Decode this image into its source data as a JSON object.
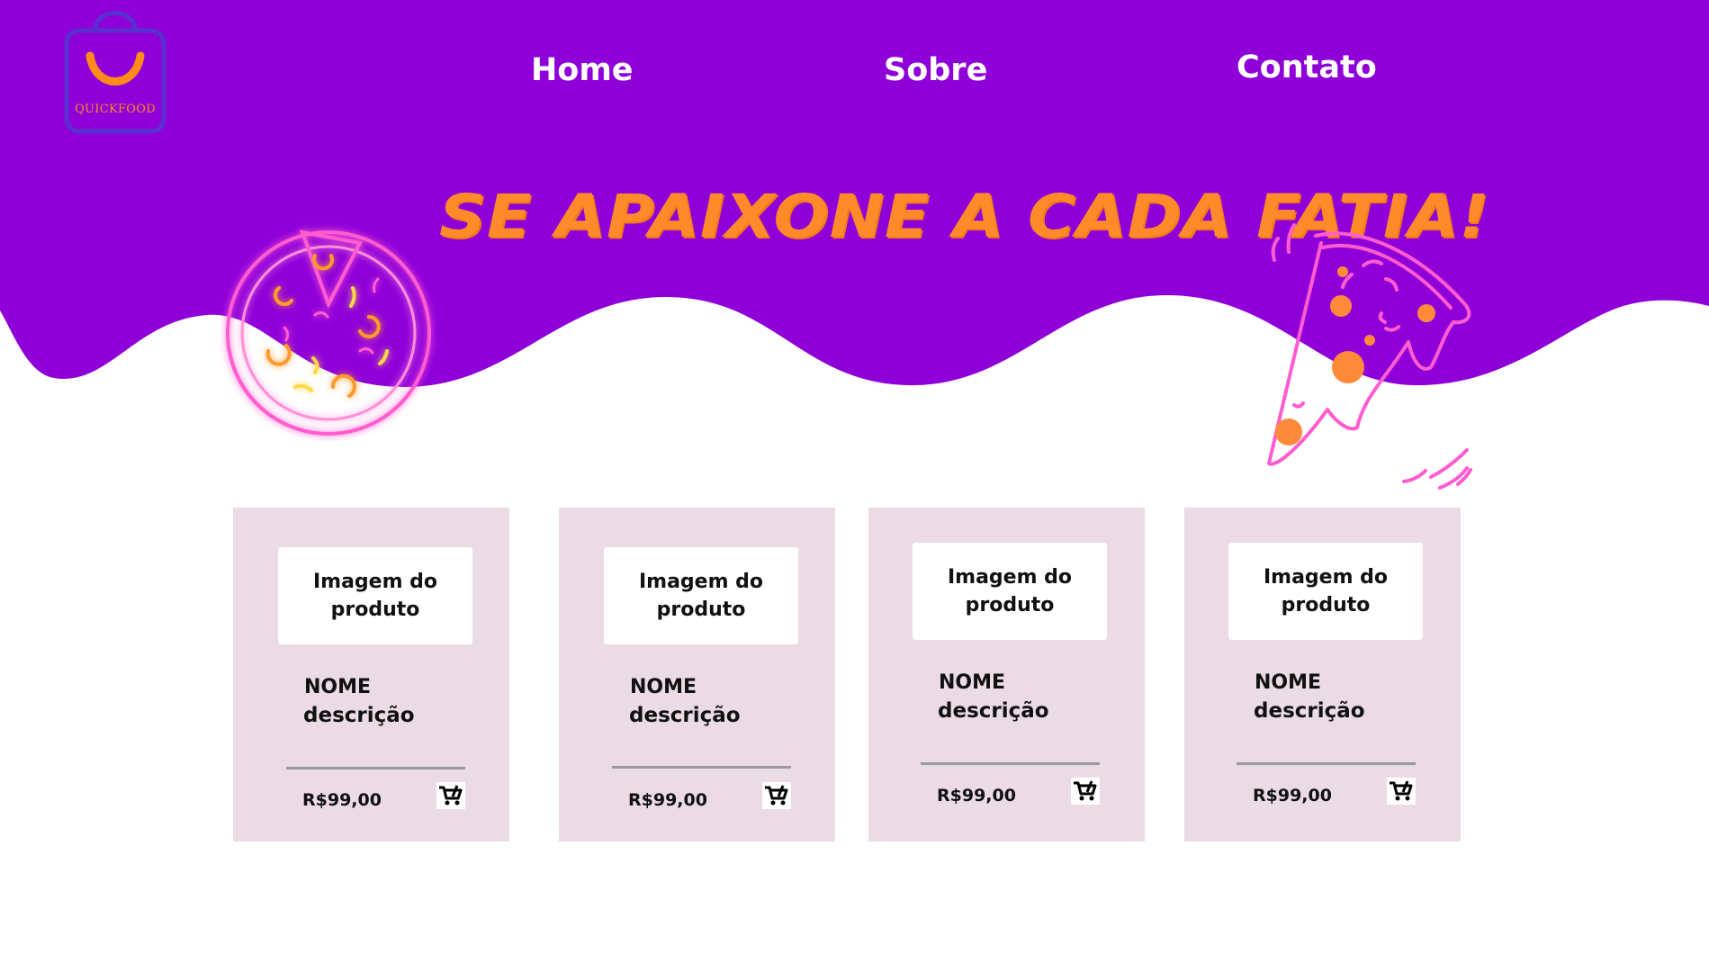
{
  "brand": {
    "name": "QUICKFOOD",
    "logo_icon": "shopping-bag-smile-icon",
    "colors": {
      "primary": "#8f00d9",
      "accent": "#ff8a2a",
      "neon_pink": "#ff5ccf",
      "card_bg": "#ebdbe5"
    }
  },
  "nav": {
    "items": [
      {
        "label": "Home"
      },
      {
        "label": "Sobre"
      },
      {
        "label": "Contato"
      }
    ]
  },
  "hero": {
    "headline": "SE APAIXONE A CADA FATIA!"
  },
  "products": [
    {
      "image_placeholder": "Imagem do produto",
      "name": "NOME",
      "description": "descrição",
      "price": "R$99,00",
      "cart_icon": "cart-icon"
    },
    {
      "image_placeholder": "Imagem do produto",
      "name": "NOME",
      "description": "descrição",
      "price": "R$99,00",
      "cart_icon": "cart-icon"
    },
    {
      "image_placeholder": "Imagem do produto",
      "name": "NOME",
      "description": "descrição",
      "price": "R$99,00",
      "cart_icon": "cart-icon"
    },
    {
      "image_placeholder": "Imagem do produto",
      "name": "NOME",
      "description": "descrição",
      "price": "R$99,00",
      "cart_icon": "cart-icon"
    }
  ]
}
